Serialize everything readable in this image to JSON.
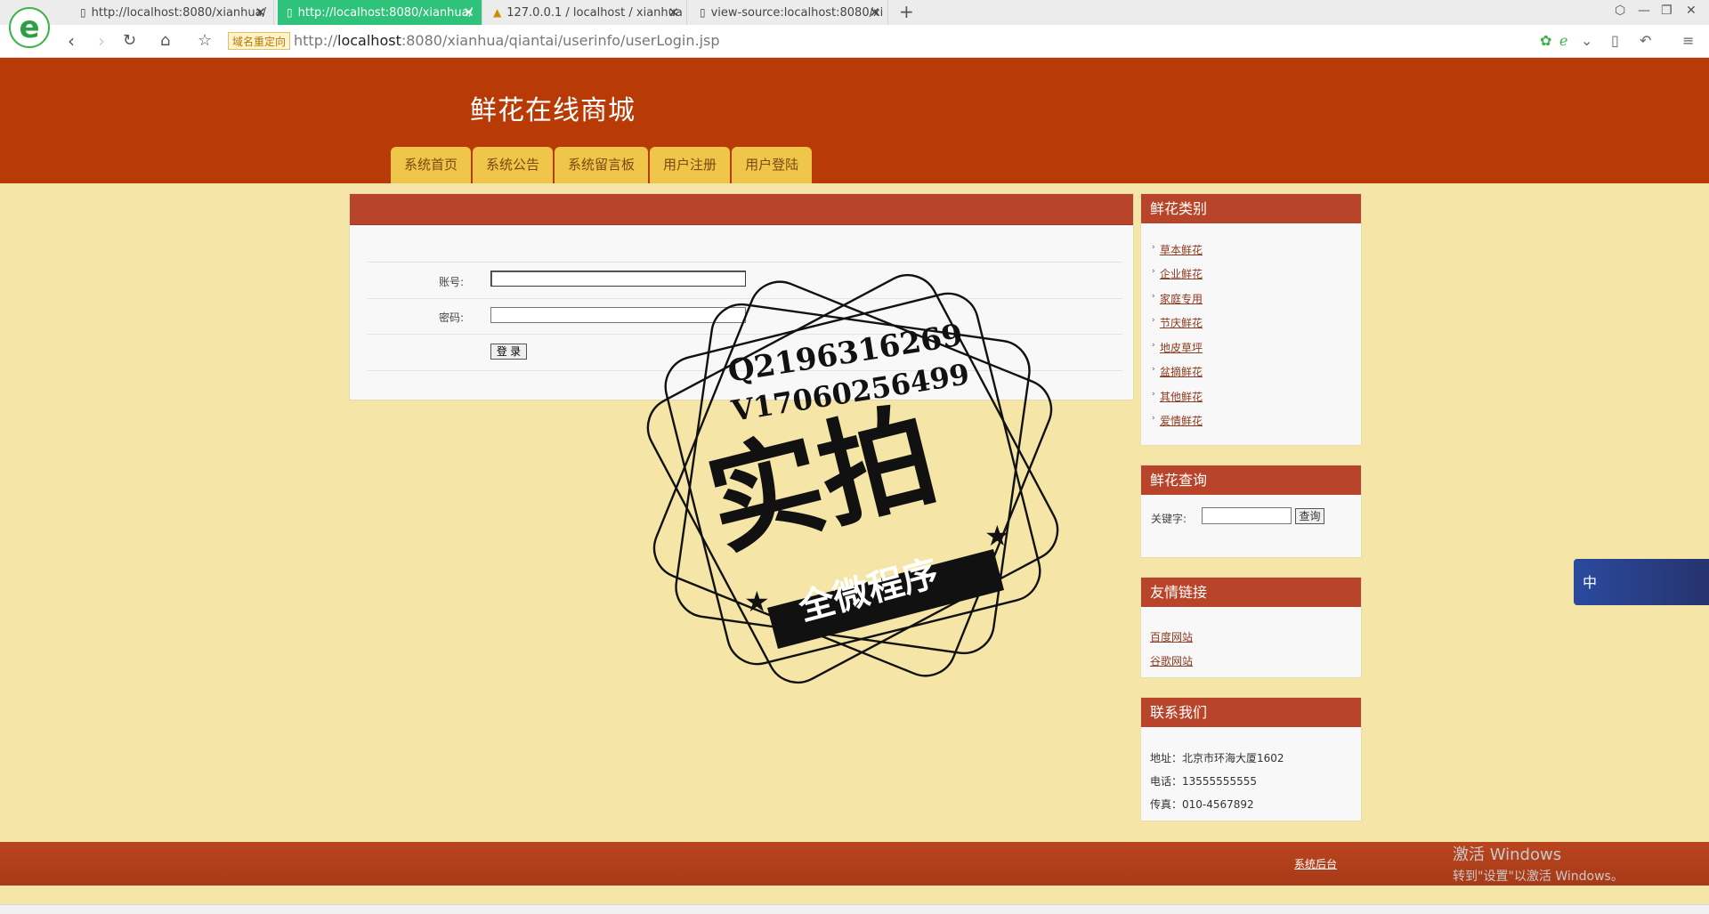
{
  "browser": {
    "logo_letter": "e",
    "tabs": [
      {
        "label": "http://localhost:8080/xianhua/",
        "active": false
      },
      {
        "label": "http://localhost:8080/xianhua/",
        "active": true
      },
      {
        "label": "127.0.0.1 / localhost / xianhua",
        "active": false
      },
      {
        "label": "view-source:localhost:8080/xi",
        "active": false
      }
    ],
    "redirect_badge": "域名重定向",
    "url_prefix": "http://",
    "url_host": "localhost",
    "url_rest": ":8080/xianhua/qiantai/userinfo/userLogin.jsp"
  },
  "header": {
    "site_title": "鲜花在线商城",
    "nav": [
      "系统首页",
      "系统公告",
      "系统留言板",
      "用户注册",
      "用户登陆"
    ]
  },
  "login": {
    "account_label": "账号:",
    "password_label": "密码:",
    "account_value": "",
    "password_value": "",
    "submit_label": "登 录"
  },
  "sidebar": {
    "categories_title": "鲜花类别",
    "categories": [
      "草本鲜花",
      "企业鲜花",
      "家庭专用",
      "节庆鲜花",
      "地皮草坪",
      "盆摘鲜花",
      "其他鲜花",
      "爱情鲜花"
    ],
    "search_title": "鲜花查询",
    "search_label": "关键字:",
    "search_button": "查询",
    "links_title": "友情链接",
    "links": [
      "百度网站",
      "谷歌网站"
    ],
    "contact_title": "联系我们",
    "contact": [
      "地址：北京市环海大厦1602",
      "电话：13555555555",
      "传真：010-4567892"
    ]
  },
  "footer": {
    "admin_link": "系统后台"
  },
  "overlay": {
    "windows_line1": "激活 Windows",
    "windows_line2": "转到\"设置\"以激活 Windows。",
    "ime_char": "中",
    "stamp_line1": "Q2196316269",
    "stamp_line2": "V17060256499",
    "stamp_main": "实拍",
    "stamp_banner": "全微程序"
  },
  "colors": {
    "header_bg": "#b83a06",
    "nav_tab": "#efc54a",
    "page_bg": "#f5e6a8",
    "panel_head": "#b8452a",
    "active_tab": "#2fc27a"
  }
}
